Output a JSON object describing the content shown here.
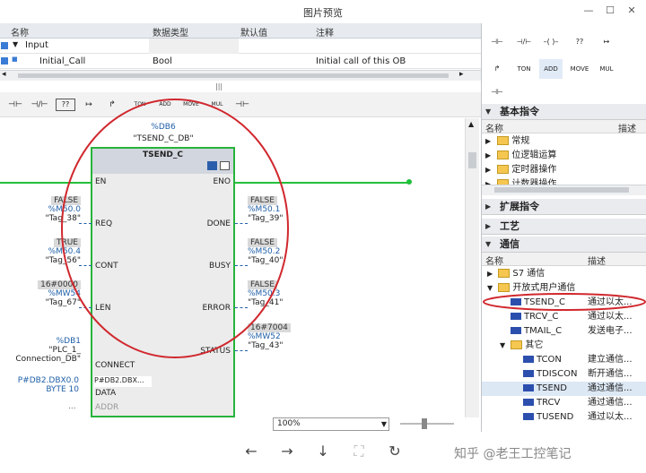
{
  "window": {
    "title": "图片预览"
  },
  "interface_table": {
    "headers": [
      "名称",
      "数据类型",
      "默认值",
      "注释"
    ],
    "group": "Input",
    "row": {
      "name": "Initial_Call",
      "type": "Bool",
      "comment": "Initial call of this OB"
    }
  },
  "toolbar": {
    "buttons": [
      "TON",
      "ADD",
      "MOVE",
      "MUL"
    ]
  },
  "block": {
    "db_tag": "%DB6",
    "db_name": "\"TSEND_C_DB\"",
    "title": "TSEND_C",
    "pins_in": [
      "EN",
      "REQ",
      "CONT",
      "LEN",
      "CONNECT",
      "DATA",
      "ADDR"
    ],
    "pins_out": [
      "ENO",
      "DONE",
      "BUSY",
      "ERROR",
      "STATUS"
    ],
    "inputs": [
      {
        "value": "FALSE",
        "tag": "%M50.0",
        "name": "\"Tag_38\""
      },
      {
        "value": "TRUE",
        "tag": "%M50.4",
        "name": "\"Tag_56\""
      },
      {
        "value": "16#0000",
        "tag": "%MW54",
        "name": "\"Tag_67\""
      }
    ],
    "connect": {
      "tag": "%DB1",
      "name1": "\"PLC_1_",
      "name2": "Connection_DB\""
    },
    "data": {
      "ptr": "P#DB2.DBX0.0",
      "len": "BYTE 10",
      "inner": "P#DB2.DBX..."
    },
    "addr_val": "...",
    "outputs": [
      {
        "value": "FALSE",
        "tag": "%M50.1",
        "name": "\"Tag_39\""
      },
      {
        "value": "FALSE",
        "tag": "%M50.2",
        "name": "\"Tag_40\""
      },
      {
        "value": "FALSE",
        "tag": "%M50.3",
        "name": "\"Tag_41\""
      },
      {
        "value": "16#7004",
        "tag": "%MW52",
        "name": "\"Tag_43\""
      }
    ]
  },
  "zoom": "100%",
  "right_panel": {
    "icons_row1": [
      "⊣⊢",
      "⊣/⊢",
      "–( )–",
      "??",
      "↦"
    ],
    "icons_row2": [
      "TON",
      "ADD",
      "MOVE",
      "MUL"
    ],
    "basic": {
      "title": "基本指令",
      "col_name": "名称",
      "col_desc": "描述",
      "items": [
        "常规",
        "位逻辑运算",
        "定时器操作",
        "计数器操作"
      ]
    },
    "extended": "扩展指令",
    "tech": "工艺",
    "comm": {
      "title": "通信",
      "col_name": "名称",
      "col_desc": "描述",
      "items": [
        {
          "label": "S7 通信",
          "desc": ""
        },
        {
          "label": "开放式用户通信",
          "desc": ""
        },
        {
          "label": "TSEND_C",
          "desc": "通过以太..."
        },
        {
          "label": "TRCV_C",
          "desc": "通过以太..."
        },
        {
          "label": "TMAIL_C",
          "desc": "发送电子..."
        },
        {
          "label": "其它",
          "desc": ""
        },
        {
          "label": "TCON",
          "desc": "建立通信..."
        },
        {
          "label": "TDISCON",
          "desc": "断开通信..."
        },
        {
          "label": "TSEND",
          "desc": "通过通信..."
        },
        {
          "label": "TRCV",
          "desc": "通过通信..."
        },
        {
          "label": "TUSEND",
          "desc": "通过以太..."
        }
      ]
    }
  },
  "watermark": "知乎 @老王工控笔记",
  "colors": {
    "wire": "#22c03a",
    "annotation": "#d0282e",
    "tag_blue": "#1f5fa8"
  }
}
